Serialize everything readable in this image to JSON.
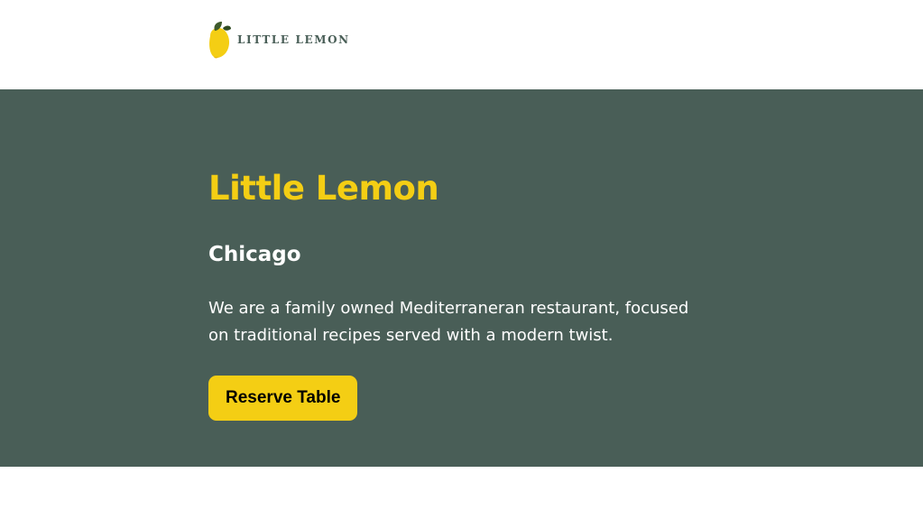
{
  "header": {
    "logo_text": "LITTLE LEMON"
  },
  "hero": {
    "title": "Little Lemon",
    "subtitle": "Chicago",
    "description": "We are a family owned Mediterraneran restaurant, focused on traditional recipes served with a modern twist.",
    "reserve_label": "Reserve Table"
  },
  "colors": {
    "brand_green": "#495e57",
    "brand_yellow": "#f4ce14",
    "leaf_green": "#3e5a2c"
  },
  "icons": {
    "logo": "lemon-icon"
  }
}
